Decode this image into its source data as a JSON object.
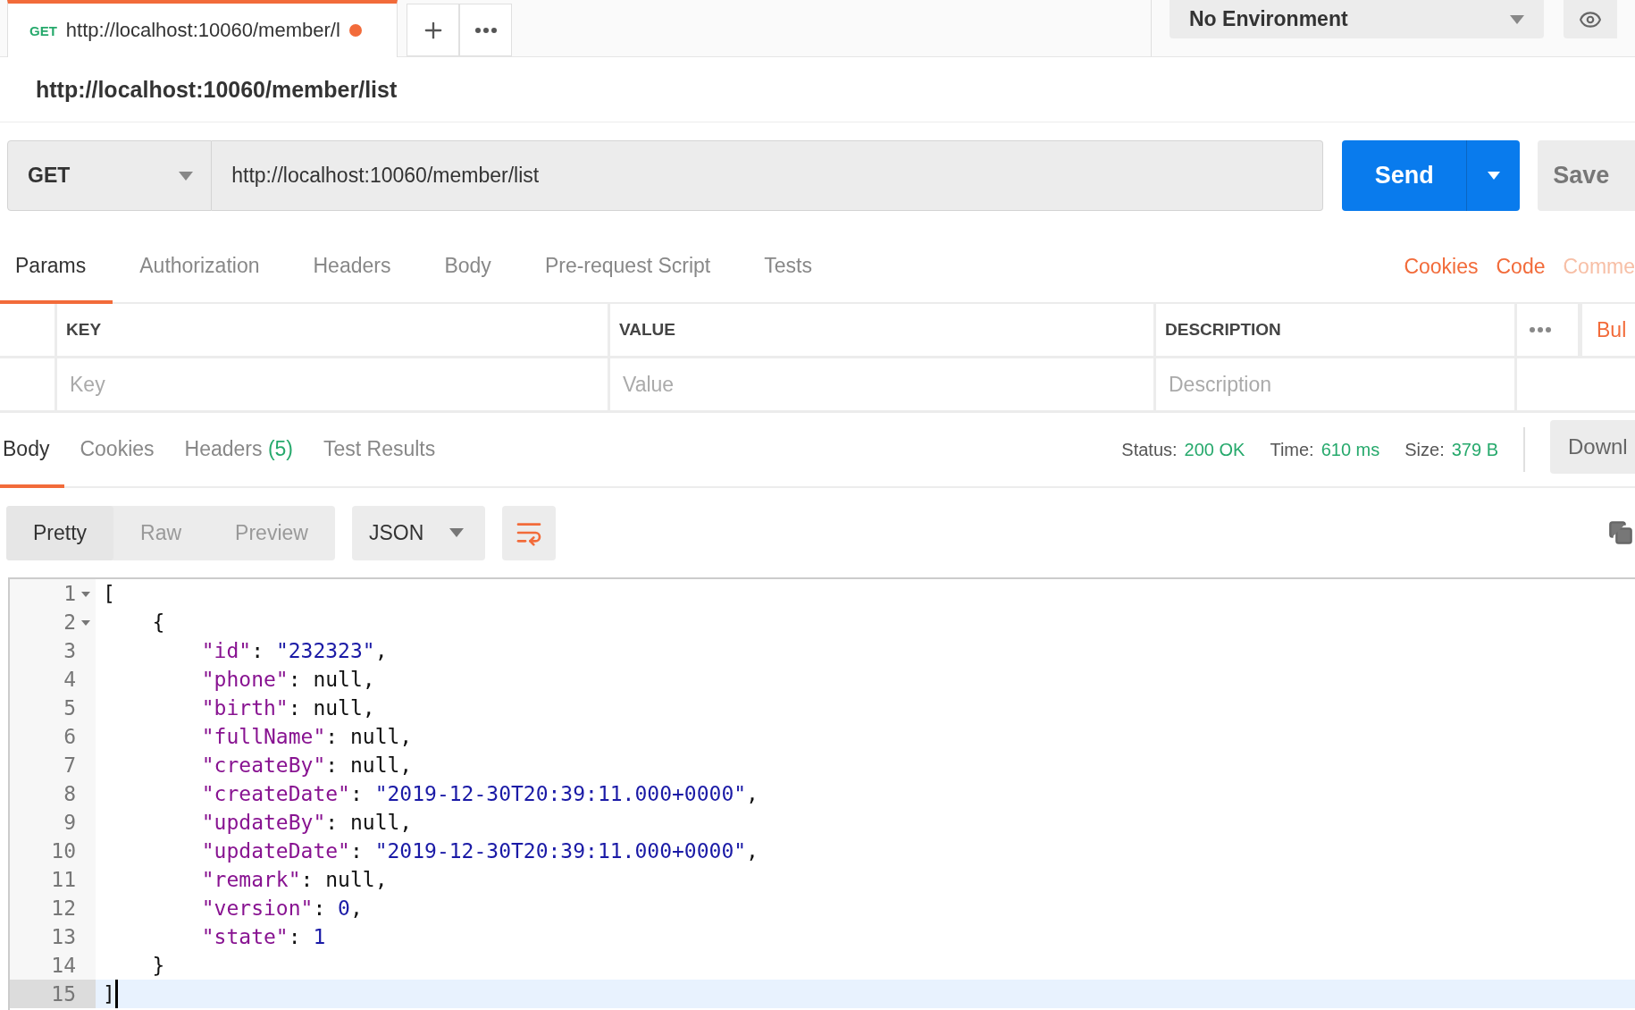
{
  "tabs": [
    {
      "method": "GET",
      "title": "http://localhost:10060/member/l",
      "unsaved": true,
      "selected": true
    }
  ],
  "environment": {
    "value": "No Environment"
  },
  "request_title": "http://localhost:10060/member/list",
  "request": {
    "method": "GET",
    "url": "http://localhost:10060/member/list",
    "send": "Send",
    "save": "Save"
  },
  "request_tabs": [
    {
      "label": "Params",
      "selected": true
    },
    {
      "label": "Authorization",
      "selected": false
    },
    {
      "label": "Headers",
      "selected": false
    },
    {
      "label": "Body",
      "selected": false
    },
    {
      "label": "Pre-request Script",
      "selected": false
    },
    {
      "label": "Tests",
      "selected": false
    }
  ],
  "request_links": [
    {
      "label": "Cookies",
      "dimmed": false
    },
    {
      "label": "Code",
      "dimmed": false
    },
    {
      "label": "Comme",
      "dimmed": true
    }
  ],
  "params": {
    "columns": [
      "KEY",
      "VALUE",
      "DESCRIPTION"
    ],
    "bulk_edit": "Bul",
    "placeholders": [
      "Key",
      "Value",
      "Description"
    ]
  },
  "response_tabs": [
    {
      "label": "Body",
      "selected": true
    },
    {
      "label": "Cookies",
      "selected": false
    },
    {
      "label": "Headers",
      "count": "(5)",
      "selected": false
    },
    {
      "label": "Test Results",
      "selected": false
    }
  ],
  "status": [
    {
      "label": "Status:",
      "value": "200 OK"
    },
    {
      "label": "Time:",
      "value": "610 ms"
    },
    {
      "label": "Size:",
      "value": "379 B"
    }
  ],
  "download": "Downl",
  "view_modes": [
    {
      "label": "Pretty",
      "selected": true
    },
    {
      "label": "Raw",
      "selected": false
    },
    {
      "label": "Preview",
      "selected": false
    }
  ],
  "format": "JSON",
  "wrap_lines": true,
  "code_lines": [
    {
      "number": "1",
      "foldable": true,
      "selected": false,
      "tokens": [
        {
          "kind": "punct",
          "text": "["
        }
      ]
    },
    {
      "number": "2",
      "foldable": true,
      "selected": false,
      "tokens": [
        {
          "kind": "punct",
          "text": "    {"
        }
      ]
    },
    {
      "number": "3",
      "foldable": false,
      "selected": false,
      "tokens": [
        {
          "kind": "key",
          "text": "        \"id\""
        },
        {
          "kind": "punct",
          "text": ": "
        },
        {
          "kind": "string",
          "text": "\"232323\""
        },
        {
          "kind": "punct",
          "text": ","
        }
      ]
    },
    {
      "number": "4",
      "foldable": false,
      "selected": false,
      "tokens": [
        {
          "kind": "key",
          "text": "        \"phone\""
        },
        {
          "kind": "punct",
          "text": ": "
        },
        {
          "kind": "null",
          "text": "null"
        },
        {
          "kind": "punct",
          "text": ","
        }
      ]
    },
    {
      "number": "5",
      "foldable": false,
      "selected": false,
      "tokens": [
        {
          "kind": "key",
          "text": "        \"birth\""
        },
        {
          "kind": "punct",
          "text": ": "
        },
        {
          "kind": "null",
          "text": "null"
        },
        {
          "kind": "punct",
          "text": ","
        }
      ]
    },
    {
      "number": "6",
      "foldable": false,
      "selected": false,
      "tokens": [
        {
          "kind": "key",
          "text": "        \"fullName\""
        },
        {
          "kind": "punct",
          "text": ": "
        },
        {
          "kind": "null",
          "text": "null"
        },
        {
          "kind": "punct",
          "text": ","
        }
      ]
    },
    {
      "number": "7",
      "foldable": false,
      "selected": false,
      "tokens": [
        {
          "kind": "key",
          "text": "        \"createBy\""
        },
        {
          "kind": "punct",
          "text": ": "
        },
        {
          "kind": "null",
          "text": "null"
        },
        {
          "kind": "punct",
          "text": ","
        }
      ]
    },
    {
      "number": "8",
      "foldable": false,
      "selected": false,
      "tokens": [
        {
          "kind": "key",
          "text": "        \"createDate\""
        },
        {
          "kind": "punct",
          "text": ": "
        },
        {
          "kind": "string",
          "text": "\"2019-12-30T20:39:11.000+0000\""
        },
        {
          "kind": "punct",
          "text": ","
        }
      ]
    },
    {
      "number": "9",
      "foldable": false,
      "selected": false,
      "tokens": [
        {
          "kind": "key",
          "text": "        \"updateBy\""
        },
        {
          "kind": "punct",
          "text": ": "
        },
        {
          "kind": "null",
          "text": "null"
        },
        {
          "kind": "punct",
          "text": ","
        }
      ]
    },
    {
      "number": "10",
      "foldable": false,
      "selected": false,
      "tokens": [
        {
          "kind": "key",
          "text": "        \"updateDate\""
        },
        {
          "kind": "punct",
          "text": ": "
        },
        {
          "kind": "string",
          "text": "\"2019-12-30T20:39:11.000+0000\""
        },
        {
          "kind": "punct",
          "text": ","
        }
      ]
    },
    {
      "number": "11",
      "foldable": false,
      "selected": false,
      "tokens": [
        {
          "kind": "key",
          "text": "        \"remark\""
        },
        {
          "kind": "punct",
          "text": ": "
        },
        {
          "kind": "null",
          "text": "null"
        },
        {
          "kind": "punct",
          "text": ","
        }
      ]
    },
    {
      "number": "12",
      "foldable": false,
      "selected": false,
      "tokens": [
        {
          "kind": "key",
          "text": "        \"version\""
        },
        {
          "kind": "punct",
          "text": ": "
        },
        {
          "kind": "number",
          "text": "0"
        },
        {
          "kind": "punct",
          "text": ","
        }
      ]
    },
    {
      "number": "13",
      "foldable": false,
      "selected": false,
      "tokens": [
        {
          "kind": "key",
          "text": "        \"state\""
        },
        {
          "kind": "punct",
          "text": ": "
        },
        {
          "kind": "number",
          "text": "1"
        }
      ]
    },
    {
      "number": "14",
      "foldable": false,
      "selected": false,
      "tokens": [
        {
          "kind": "punct",
          "text": "    }"
        }
      ]
    },
    {
      "number": "15",
      "foldable": false,
      "selected": true,
      "tokens": [
        {
          "kind": "punct",
          "text": "]"
        }
      ]
    }
  ]
}
